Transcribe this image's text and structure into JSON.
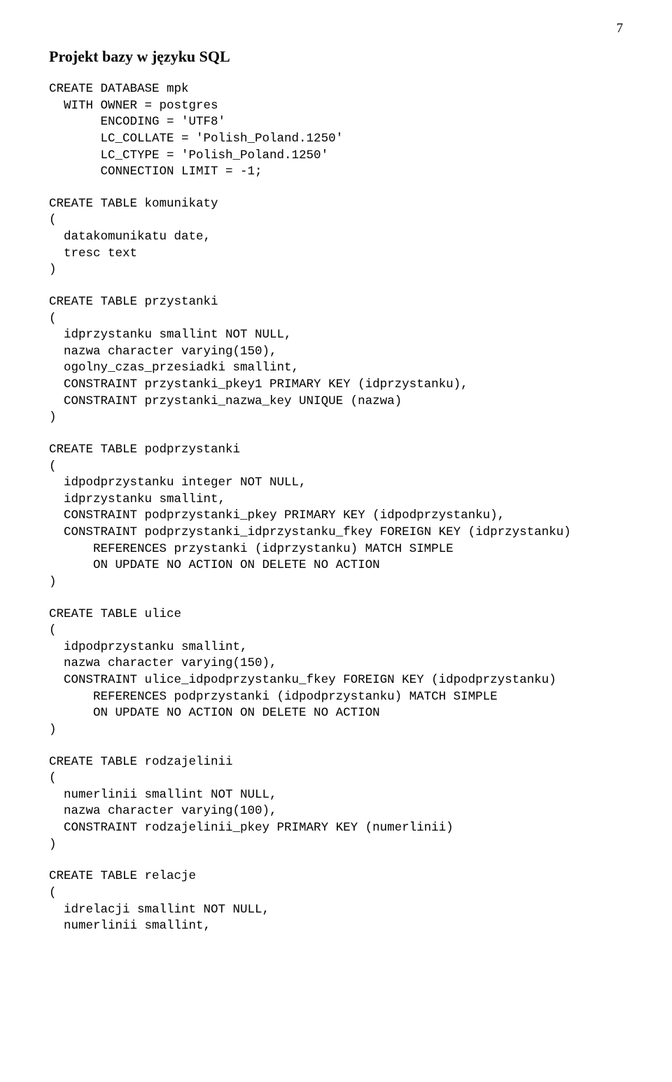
{
  "page_number": "7",
  "heading": "Projekt bazy w języku SQL",
  "blocks": {
    "b0": "CREATE DATABASE mpk\n  WITH OWNER = postgres\n       ENCODING = 'UTF8'\n       LC_COLLATE = 'Polish_Poland.1250'\n       LC_CTYPE = 'Polish_Poland.1250'\n       CONNECTION LIMIT = -1;",
    "b1": "CREATE TABLE komunikaty\n(\n  datakomunikatu date,\n  tresc text\n)",
    "b2": "CREATE TABLE przystanki\n(\n  idprzystanku smallint NOT NULL,\n  nazwa character varying(150),\n  ogolny_czas_przesiadki smallint,\n  CONSTRAINT przystanki_pkey1 PRIMARY KEY (idprzystanku),\n  CONSTRAINT przystanki_nazwa_key UNIQUE (nazwa)\n)",
    "b3": "CREATE TABLE podprzystanki\n(\n  idpodprzystanku integer NOT NULL,\n  idprzystanku smallint,\n  CONSTRAINT podprzystanki_pkey PRIMARY KEY (idpodprzystanku),\n  CONSTRAINT podprzystanki_idprzystanku_fkey FOREIGN KEY (idprzystanku)\n      REFERENCES przystanki (idprzystanku) MATCH SIMPLE\n      ON UPDATE NO ACTION ON DELETE NO ACTION\n)",
    "b4": "CREATE TABLE ulice\n(\n  idpodprzystanku smallint,\n  nazwa character varying(150),\n  CONSTRAINT ulice_idpodprzystanku_fkey FOREIGN KEY (idpodprzystanku)\n      REFERENCES podprzystanki (idpodprzystanku) MATCH SIMPLE\n      ON UPDATE NO ACTION ON DELETE NO ACTION\n)",
    "b5": "CREATE TABLE rodzajelinii\n(\n  numerlinii smallint NOT NULL,\n  nazwa character varying(100),\n  CONSTRAINT rodzajelinii_pkey PRIMARY KEY (numerlinii)\n)",
    "b6": "CREATE TABLE relacje\n(\n  idrelacji smallint NOT NULL,\n  numerlinii smallint,"
  }
}
